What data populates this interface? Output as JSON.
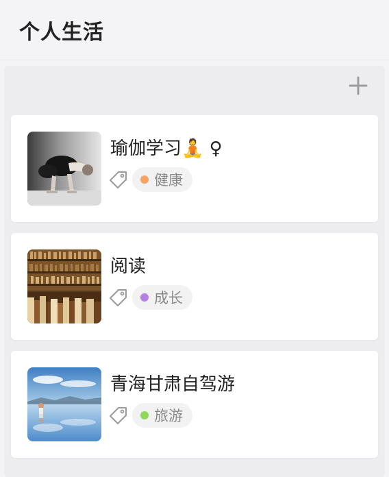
{
  "header": {
    "title": "个人生活"
  },
  "column": {
    "add_icon": "plus-icon"
  },
  "cards": [
    {
      "title": "瑜伽学习🧘 ♀",
      "tag": {
        "label": "健康",
        "color": "#f5a462"
      }
    },
    {
      "title": "阅读",
      "tag": {
        "label": "成长",
        "color": "#b57fe6"
      }
    },
    {
      "title": "青海甘肃自驾游",
      "tag": {
        "label": "旅游",
        "color": "#8fd85c"
      }
    }
  ]
}
